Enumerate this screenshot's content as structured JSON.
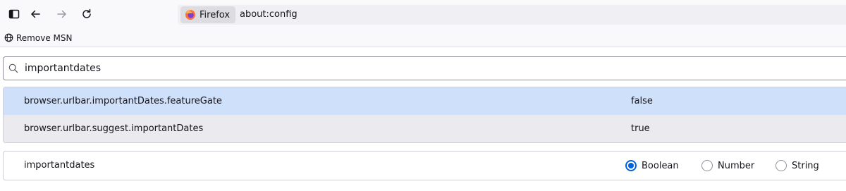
{
  "toolbar": {
    "sidebar_icon": "sidebar-icon",
    "back_icon": "back-arrow-icon",
    "forward_icon": "forward-arrow-icon",
    "reload_icon": "reload-icon",
    "identity_label": "Firefox",
    "url": "about:config"
  },
  "bookmarks": {
    "items": [
      {
        "label": "Remove MSN",
        "icon": "globe-icon"
      }
    ]
  },
  "search": {
    "value": "importantdates",
    "icon": "search-icon"
  },
  "prefs": [
    {
      "name": "browser.urlbar.importantDates.featureGate",
      "value": "false",
      "selected": true
    },
    {
      "name": "browser.urlbar.suggest.importantDates",
      "value": "true",
      "selected": false
    }
  ],
  "new_pref": {
    "name": "importantdates",
    "types": [
      {
        "label": "Boolean",
        "checked": true
      },
      {
        "label": "Number",
        "checked": false
      },
      {
        "label": "String",
        "checked": false
      }
    ]
  },
  "colors": {
    "selected_row": "#cfe0fb",
    "alt_row": "#ebebef",
    "accent": "#0061e0",
    "toolbar_bg": "#f9f9fb"
  }
}
